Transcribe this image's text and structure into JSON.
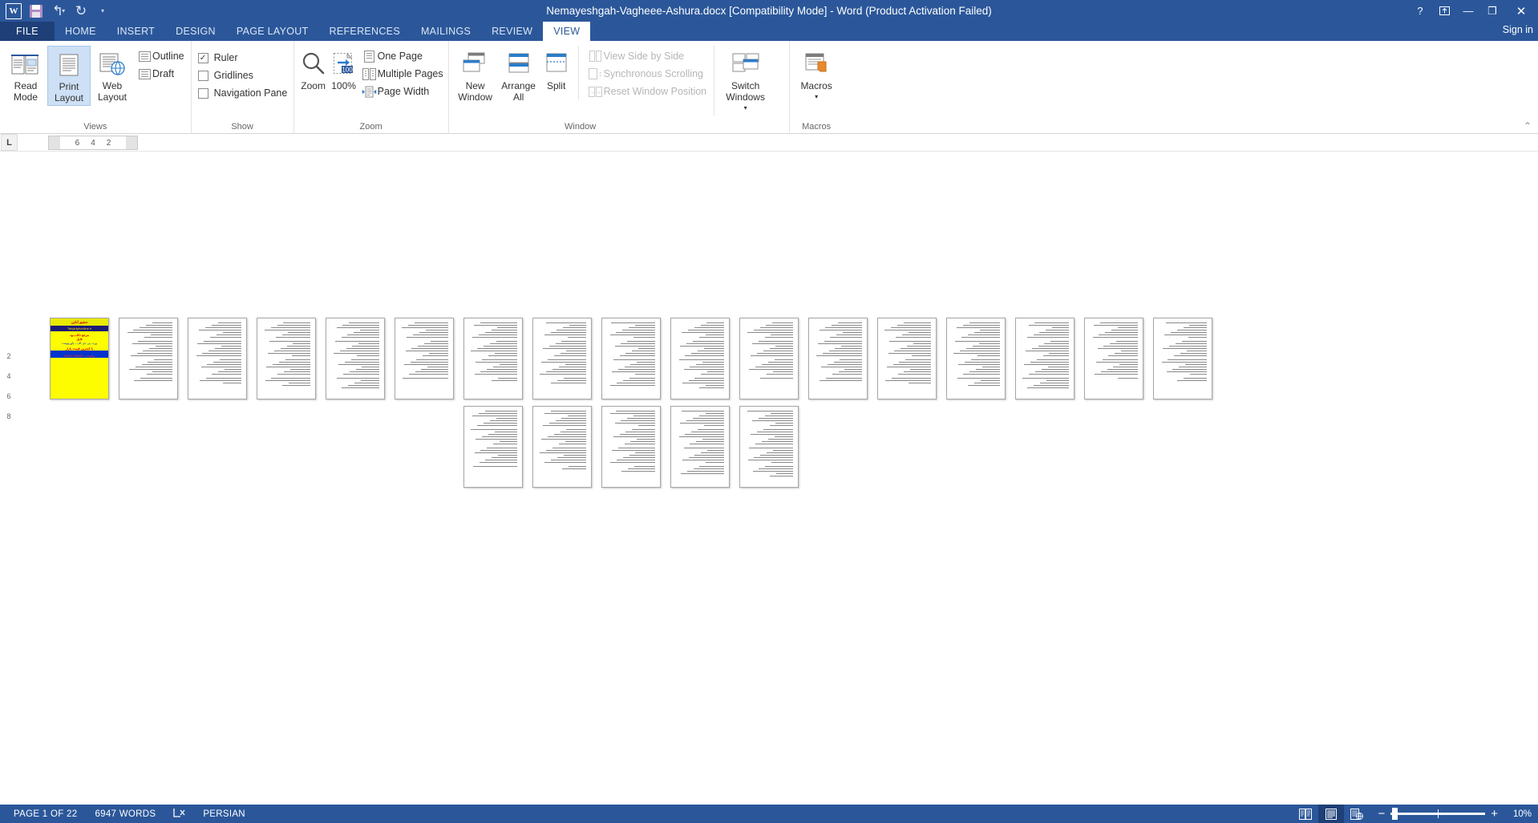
{
  "titlebar": {
    "document_title": "Nemayeshgah-Vagheee-Ashura.docx [Compatibility Mode] - Word (Product Activation Failed)",
    "app_logo": "word-logo",
    "quick_access": [
      {
        "name": "save-icon",
        "label": "Save"
      },
      {
        "name": "undo-icon",
        "label": "↰"
      },
      {
        "name": "redo-icon",
        "label": "↻"
      },
      {
        "name": "customize-qat-icon",
        "label": "▾"
      }
    ],
    "window_controls": {
      "help": "?",
      "ribbon_display_options": "⬆",
      "minimize": "—",
      "restore": "❐",
      "close": "✕"
    },
    "sign_in": "Sign in"
  },
  "tabs": [
    {
      "label": "FILE",
      "active": false,
      "file": true
    },
    {
      "label": "HOME",
      "active": false
    },
    {
      "label": "INSERT",
      "active": false
    },
    {
      "label": "DESIGN",
      "active": false
    },
    {
      "label": "PAGE LAYOUT",
      "active": false
    },
    {
      "label": "REFERENCES",
      "active": false
    },
    {
      "label": "MAILINGS",
      "active": false
    },
    {
      "label": "REVIEW",
      "active": false
    },
    {
      "label": "VIEW",
      "active": true
    }
  ],
  "ribbon": {
    "collapse_icon": "⌃",
    "groups": {
      "views": {
        "label": "Views",
        "buttons": [
          {
            "label": "Read Mode",
            "icon": "read-mode-icon",
            "selected": false
          },
          {
            "label": "Print Layout",
            "icon": "print-layout-icon",
            "selected": true
          },
          {
            "label": "Web Layout",
            "icon": "web-layout-icon",
            "selected": false
          }
        ],
        "small_items": [
          {
            "label": "Outline",
            "icon": "outline-icon"
          },
          {
            "label": "Draft",
            "icon": "draft-icon"
          }
        ]
      },
      "show": {
        "label": "Show",
        "checkboxes": [
          {
            "label": "Ruler",
            "checked": true,
            "check_glyph": "✓"
          },
          {
            "label": "Gridlines",
            "checked": false,
            "check_glyph": ""
          },
          {
            "label": "Navigation Pane",
            "checked": false,
            "check_glyph": ""
          }
        ]
      },
      "zoom": {
        "label": "Zoom",
        "buttons": [
          {
            "label": "Zoom",
            "icon": "magnifier-icon"
          },
          {
            "label": "100%",
            "icon": "one-hundred-percent-icon",
            "badge": "100"
          }
        ],
        "small_items": [
          {
            "label": "One Page",
            "icon": "one-page-icon"
          },
          {
            "label": "Multiple Pages",
            "icon": "multiple-pages-icon"
          },
          {
            "label": "Page Width",
            "icon": "page-width-icon"
          }
        ]
      },
      "window": {
        "label": "Window",
        "buttons": [
          {
            "label": "New Window",
            "icon": "new-window-icon"
          },
          {
            "label": "Arrange All",
            "icon": "arrange-all-icon"
          },
          {
            "label": "Split",
            "icon": "split-icon"
          }
        ],
        "small_items": [
          {
            "label": "View Side by Side",
            "icon": "view-side-by-side-icon",
            "disabled": true
          },
          {
            "label": "Synchronous Scrolling",
            "icon": "synchronous-scrolling-icon",
            "disabled": true
          },
          {
            "label": "Reset Window Position",
            "icon": "reset-window-position-icon",
            "disabled": true
          }
        ],
        "switch_windows": {
          "label": "Switch Windows",
          "icon": "switch-windows-icon",
          "caret": "▾"
        }
      },
      "macros": {
        "label": "Macros",
        "button": {
          "label": "Macros",
          "icon": "macros-icon",
          "caret": "▾"
        }
      }
    }
  },
  "ruler": {
    "tab_selector": "L",
    "marks": [
      "6",
      "4",
      "2"
    ]
  },
  "vertical_ruler": {
    "marks": [
      "2",
      "4",
      "6",
      "8"
    ]
  },
  "document": {
    "total_pages": 22,
    "cover": {
      "site_name": "Tahghighonline.ir",
      "line1": "تحقیق آنلاین",
      "line2": "مرجع دانلــــود",
      "line3": "فایل",
      "line4": "ورد، پی دی اف ، پاورپوینت",
      "line5": "با کمترین قیمت بازار",
      "phone": "09361766657 واتساپ"
    },
    "row1_page_count": 17,
    "row2_page_count": 5
  },
  "statusbar": {
    "page_indicator": "PAGE 1 OF 22",
    "word_count": "6947 WORDS",
    "proofing_icon": "proofing-errors-icon",
    "language": "PERSIAN",
    "view_buttons": [
      {
        "name": "read-mode-view-button",
        "icon": "read-mode-icon",
        "selected": false
      },
      {
        "name": "print-layout-view-button",
        "icon": "print-layout-icon",
        "selected": true
      },
      {
        "name": "web-layout-view-button",
        "icon": "web-layout-icon",
        "selected": false
      }
    ],
    "zoom_out": "−",
    "zoom_in": "+",
    "zoom_level": "10%"
  },
  "colors": {
    "word_blue": "#2b579a",
    "file_tab_blue": "#1e3f77",
    "selected_highlight": "#cde0f5",
    "cover_yellow": "#fdfd00"
  }
}
